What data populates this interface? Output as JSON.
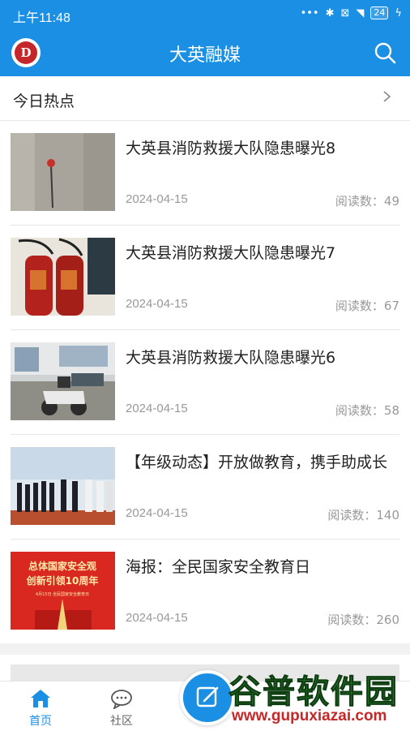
{
  "status": {
    "time": "上午11:48",
    "battery": "24"
  },
  "app": {
    "title": "大英融媒",
    "logo_letter": "D"
  },
  "section": {
    "label": "今日热点"
  },
  "articles": [
    {
      "title": "大英县消防救援大队隐患曝光8",
      "date": "2024-04-15",
      "reads": "阅读数：49"
    },
    {
      "title": "大英县消防救援大队隐患曝光7",
      "date": "2024-04-15",
      "reads": "阅读数：67"
    },
    {
      "title": "大英县消防救援大队隐患曝光6",
      "date": "2024-04-15",
      "reads": "阅读数：58"
    },
    {
      "title": "【年级动态】开放做教育，携手助成长",
      "date": "2024-04-15",
      "reads": "阅读数：140"
    },
    {
      "title": "海报：全民国家安全教育日",
      "date": "2024-04-15",
      "reads": "阅读数：260"
    }
  ],
  "poster": {
    "line1": "总体国家安全观",
    "line2": "创新引领10周年",
    "line3": "4月15日 全民国家安全教育日"
  },
  "tabs": {
    "home": "首页",
    "community": "社区"
  },
  "watermark": {
    "big": "谷普软件园",
    "small": "www.gupuxiazai.com"
  },
  "colors": {
    "brand": "#1a8fe3",
    "accent_red": "#c4262a"
  }
}
